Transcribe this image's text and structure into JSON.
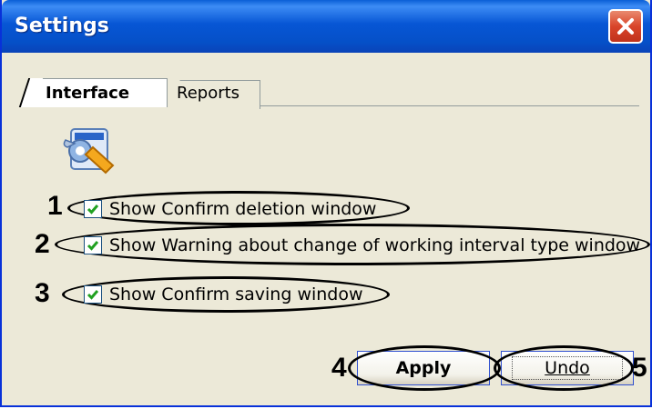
{
  "window": {
    "title": "Settings",
    "close_icon": "close-icon"
  },
  "tabs": [
    {
      "label": "Interface",
      "selected": true
    },
    {
      "label": "Reports",
      "selected": false
    }
  ],
  "icon": "settings-tools-icon",
  "options": [
    {
      "number": "1",
      "label": "Show Confirm deletion window",
      "checked": true
    },
    {
      "number": "2",
      "label": "Show Warning about change of working interval type window",
      "checked": true
    },
    {
      "number": "3",
      "label": "Show Confirm saving window",
      "checked": true
    }
  ],
  "buttons": {
    "apply": {
      "number": "4",
      "label": "Apply"
    },
    "undo": {
      "number": "5",
      "label": "Undo"
    }
  },
  "colors": {
    "titlebar": "#0756d5",
    "window_bg": "#ece9d8",
    "check": "#21a121",
    "close": "#d9452a"
  }
}
